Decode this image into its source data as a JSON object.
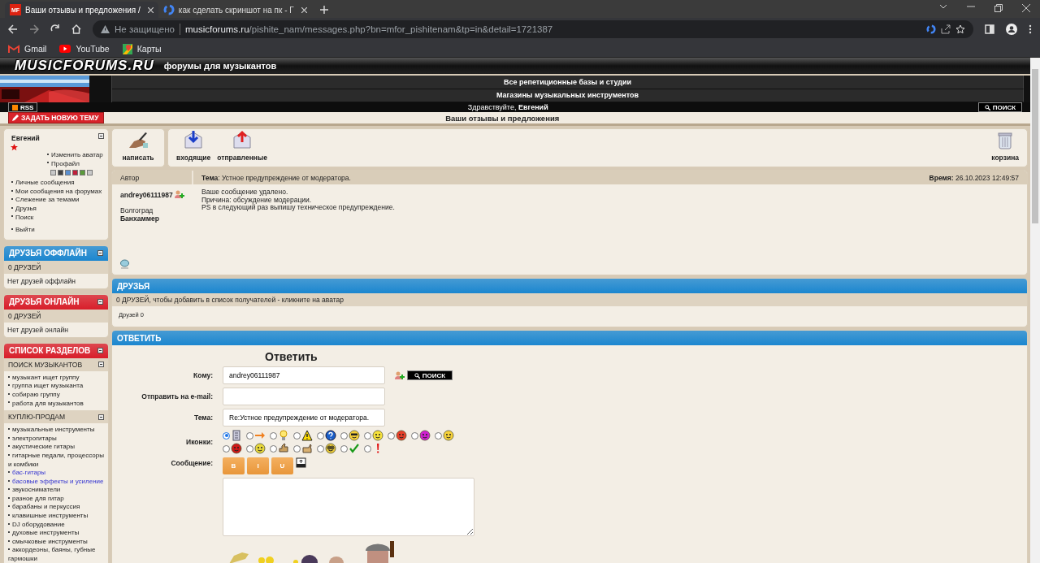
{
  "browser": {
    "tabs": [
      {
        "favicon": "MF",
        "title": "Ваши отзывы и предложения /",
        "selected": true
      },
      {
        "title": "как сделать скриншот на пк - Г",
        "selected": false
      }
    ],
    "security": "Не защищено",
    "url_host": "musicforums.ru",
    "url_path": "/pishite_nam/messages.php?bn=mfor_pishitenam&tp=in&detail=1721387",
    "bookmarks": [
      {
        "label": "Gmail",
        "kind": "gmail"
      },
      {
        "label": "YouTube",
        "kind": "youtube"
      },
      {
        "label": "Карты",
        "kind": "maps"
      }
    ]
  },
  "site": {
    "logo": "MUSICFORUMS.RU",
    "tagline": "форумы для музыкантов",
    "banner_links": [
      "Все репетиционные базы и студии",
      "Магазины музыкальных инструментов"
    ],
    "rss": "RSS",
    "greeting": "Здравствуйте, **Евгений**",
    "search": "ПОИСК",
    "new_topic": "ЗАДАТЬ НОВУЮ ТЕМУ",
    "page_title": "Ваши отзывы и предложения"
  },
  "user_panel": {
    "name": "Евгений",
    "links": [
      "Изменить аватар",
      "Профайл"
    ],
    "themes": [
      {
        "color": "#c8c8c8"
      },
      {
        "color": "#404040"
      },
      {
        "color": "#5a8fd0"
      },
      {
        "color": "#c0203a"
      },
      {
        "color": "#5a9a3a"
      },
      {
        "color": "#c8c8c8"
      }
    ],
    "menu": [
      "Личные сообщения",
      "Мои сообщения на форумах",
      "Слежение за темами",
      "Друзья",
      "Поиск"
    ],
    "logout": "Выйти"
  },
  "friend_panels": [
    {
      "title": "ДРУЗЬЯ ОФФЛАЙН",
      "color": "#1b86cf",
      "count": "0 ДРУЗЕЙ",
      "text": "Нет друзей оффлайн"
    },
    {
      "title": "ДРУЗЬЯ ОНЛАЙН",
      "color": "#d81e2a",
      "count": "0 ДРУЗЕЙ",
      "text": "Нет друзей онлайн"
    }
  ],
  "sections": {
    "title": "СПИСОК РАЗДЕЛОВ",
    "color": "#d81e2a",
    "groups": [
      {
        "title": "ПОИСК МУЗЫКАНТОВ",
        "items": [
          {
            "label": "музыкант ищет группу",
            "visited": false
          },
          {
            "label": "группа ищет музыканта",
            "visited": false
          },
          {
            "label": "собираю группу",
            "visited": false
          },
          {
            "label": "работа для музыкантов",
            "visited": false
          }
        ]
      },
      {
        "title": "КУПЛЮ-ПРОДАМ",
        "items": [
          {
            "label": "музыкальные инструменты",
            "visited": false
          },
          {
            "label": "электрогитары",
            "visited": false
          },
          {
            "label": "акустические гитары",
            "visited": false
          },
          {
            "label": "гитарные педали, процессоры и комбики",
            "visited": false
          },
          {
            "label": "бас-гитары",
            "visited": true
          },
          {
            "label": "басовые эффекты и усиление",
            "visited": true
          },
          {
            "label": "звукосниматели",
            "visited": false
          },
          {
            "label": "разное для гитар",
            "visited": false
          },
          {
            "label": "барабаны и перкуссия",
            "visited": false
          },
          {
            "label": "клавишные инструменты",
            "visited": false
          },
          {
            "label": "DJ оборудование",
            "visited": false
          },
          {
            "label": "духовые инструменты",
            "visited": false
          },
          {
            "label": "смычковые инструменты",
            "visited": false
          },
          {
            "label": "аккордеоны, баяны, губные гармошки",
            "visited": false
          }
        ]
      }
    ]
  },
  "toolbar": {
    "items": [
      {
        "label": "написать",
        "kind": "write"
      },
      {
        "label": "входящие",
        "kind": "inbox"
      },
      {
        "label": "отправленные",
        "kind": "sent"
      }
    ],
    "trash": "корзина"
  },
  "message": {
    "author_header": "Автор",
    "subject": "**Тема**: Устное предупреждение от модератора.",
    "time": "**Время:** 26.10.2023 12:49:57",
    "author": "andrey06111987",
    "city": "Волгоград",
    "rank": "Банхаммер",
    "body": [
      "Ваше сообщение удалено.",
      "Причина: обсуждение модерации.",
      "PS в следующий раз выпишу техническое предупреждение."
    ]
  },
  "friends": {
    "title": "ДРУЗЬЯ",
    "color": "#1b86cf",
    "info": "0 ДРУЗЕЙ, чтобы добавить в список получателей - кликните на аватар",
    "count": "Друзей 0"
  },
  "reply": {
    "title": "ОТВЕТИТЬ",
    "color": "#1b86cf",
    "heading": "Ответить",
    "to_label": "Кому:",
    "to_value": "andrey06111987",
    "search": "ПОИСК",
    "email_label": "Отправить на e-mail:",
    "subject_label": "Тема:",
    "subject_value": "Re:Устное предупреждение от модератора.",
    "icons_label": "Иконки:",
    "icons": [
      {
        "kind": "note",
        "selected": true
      },
      {
        "kind": "arrow",
        "selected": false
      },
      {
        "kind": "bulb",
        "selected": false
      },
      {
        "kind": "warning",
        "selected": false
      },
      {
        "kind": "question",
        "selected": false
      },
      {
        "kind": "cool",
        "selected": false
      },
      {
        "kind": "smile",
        "selected": false
      },
      {
        "kind": "angry",
        "selected": false
      },
      {
        "kind": "purple",
        "selected": false
      },
      {
        "kind": "grin",
        "selected": false
      },
      {
        "kind": "mad",
        "selected": false
      },
      {
        "kind": "wink",
        "selected": false
      },
      {
        "kind": "thumbs",
        "selected": false
      },
      {
        "kind": "hand",
        "selected": false
      },
      {
        "kind": "glasses",
        "selected": false
      },
      {
        "kind": "check",
        "selected": false
      },
      {
        "kind": "exclaim",
        "selected": false
      }
    ],
    "message_label": "Сообщение:",
    "format_buttons": [
      "B",
      "I",
      "U"
    ]
  }
}
